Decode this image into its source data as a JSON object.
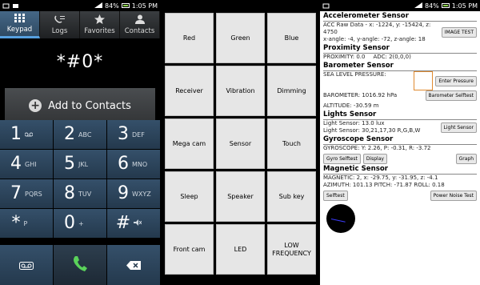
{
  "statusbar1": {
    "battery": "84%",
    "time": "1:05 PM"
  },
  "statusbar2": {
    "battery": "84%",
    "time": "1:05 PM"
  },
  "dialer": {
    "tabs": [
      {
        "label": "Keypad",
        "icon": "keypad-icon"
      },
      {
        "label": "Logs",
        "icon": "logs-icon"
      },
      {
        "label": "Favorites",
        "icon": "star-icon"
      },
      {
        "label": "Contacts",
        "icon": "person-icon"
      }
    ],
    "number": "*#0*",
    "add_contacts": "Add to Contacts",
    "keys": [
      {
        "digit": "1",
        "letters": ""
      },
      {
        "digit": "2",
        "letters": "ABC"
      },
      {
        "digit": "3",
        "letters": "DEF"
      },
      {
        "digit": "4",
        "letters": "GHI"
      },
      {
        "digit": "5",
        "letters": "JKL"
      },
      {
        "digit": "6",
        "letters": "MNO"
      },
      {
        "digit": "7",
        "letters": "PQRS"
      },
      {
        "digit": "8",
        "letters": "TUV"
      },
      {
        "digit": "9",
        "letters": "WXYZ"
      },
      {
        "digit": "*",
        "letters": "P"
      },
      {
        "digit": "0",
        "letters": "+"
      },
      {
        "digit": "#",
        "letters": ""
      }
    ]
  },
  "testgrid": {
    "buttons": [
      "Red",
      "Green",
      "Blue",
      "Receiver",
      "Vibration",
      "Dimming",
      "Mega cam",
      "Sensor",
      "Touch",
      "Sleep",
      "Speaker",
      "Sub key",
      "Front cam",
      "LED",
      "LOW FREQUENCY"
    ]
  },
  "sensors": {
    "accel": {
      "title": "Accelerometer Sensor",
      "line1": "ACC Raw Data - x: -1224, y: -15424, z: 4750",
      "line2": "x-angle: -4, y-angle: -72, z-angle: 18",
      "button": "IMAGE TEST"
    },
    "proximity": {
      "title": "Proximity Sensor",
      "line1": "PROXIMITY: 0.0",
      "line2": "ADC: 2(0,0,0)"
    },
    "barometer": {
      "title": "Barometer Sensor",
      "sea_level": "SEA LEVEL PRESSURE:",
      "enter_button": "Enter Pressure",
      "pressure": "BAROMETER: 1016.92 hPa",
      "selftest_button": "Barometer Selftest",
      "altitude": "ALTITUDE: -30.59 m"
    },
    "lights": {
      "title": "Lights Sensor",
      "line1": "Light Sensor: 13.0 lux",
      "line2": "Light Sensor: 30,21,17,30 R,G,B,W",
      "button": "Light Sensor"
    },
    "gyro": {
      "title": "Gyroscope Sensor",
      "line1": "GYROSCOPE: Y: 2.26, P: -0.31, R: -3.72",
      "selftest": "Gyro Selftest",
      "display": "Display",
      "graph": "Graph"
    },
    "magnetic": {
      "title": "Magnetic Sensor",
      "line1": "MAGNETIC: 2, x: -29.75, y: -31.95, z: -4.1",
      "line2": "AZIMUTH: 101.13   PITCH: -71.87   ROLL: 0.18",
      "selftest": "Selftest",
      "power_noise": "Power Noise Test"
    }
  }
}
